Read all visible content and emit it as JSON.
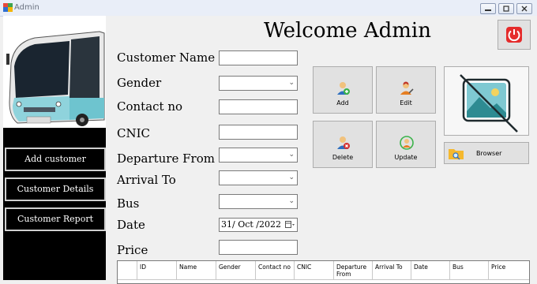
{
  "window": {
    "title": "Admin",
    "controls": [
      "minimize-icon",
      "maximize-icon",
      "close-icon"
    ]
  },
  "sidebar": {
    "image_icon": "bus-icon",
    "buttons": [
      {
        "label": "Add customer"
      },
      {
        "label": "Customer Details"
      },
      {
        "label": "Customer Report"
      }
    ]
  },
  "header": {
    "welcome": "Welcome Admin",
    "power_icon": "power-icon"
  },
  "form": {
    "customer_name": {
      "label": "Customer Name",
      "value": ""
    },
    "gender": {
      "label": "Gender",
      "value": ""
    },
    "contact": {
      "label": "Contact no",
      "value": ""
    },
    "cnic": {
      "label": "CNIC",
      "value": ""
    },
    "departure": {
      "label": "Departure From",
      "value": ""
    },
    "arrival": {
      "label": "Arrival To",
      "value": ""
    },
    "bus": {
      "label": "Bus",
      "value": ""
    },
    "date": {
      "label": "Date",
      "value": "31/ Oct /2022"
    },
    "price": {
      "label": "Price",
      "value": ""
    }
  },
  "actions": {
    "add": "Add",
    "edit": "Edit",
    "delete": "Delete",
    "update": "Update",
    "browse": "Browser"
  },
  "table": {
    "columns": [
      "ID",
      "Name",
      "Gender",
      "Contact no",
      "CNIC",
      "Departure From",
      "Arrival To",
      "Date",
      "Bus",
      "Price"
    ]
  },
  "colors": {
    "sidebar_bg": "#000000",
    "power_red": "#e52b2b",
    "window_bg": "#f0f0f0"
  }
}
